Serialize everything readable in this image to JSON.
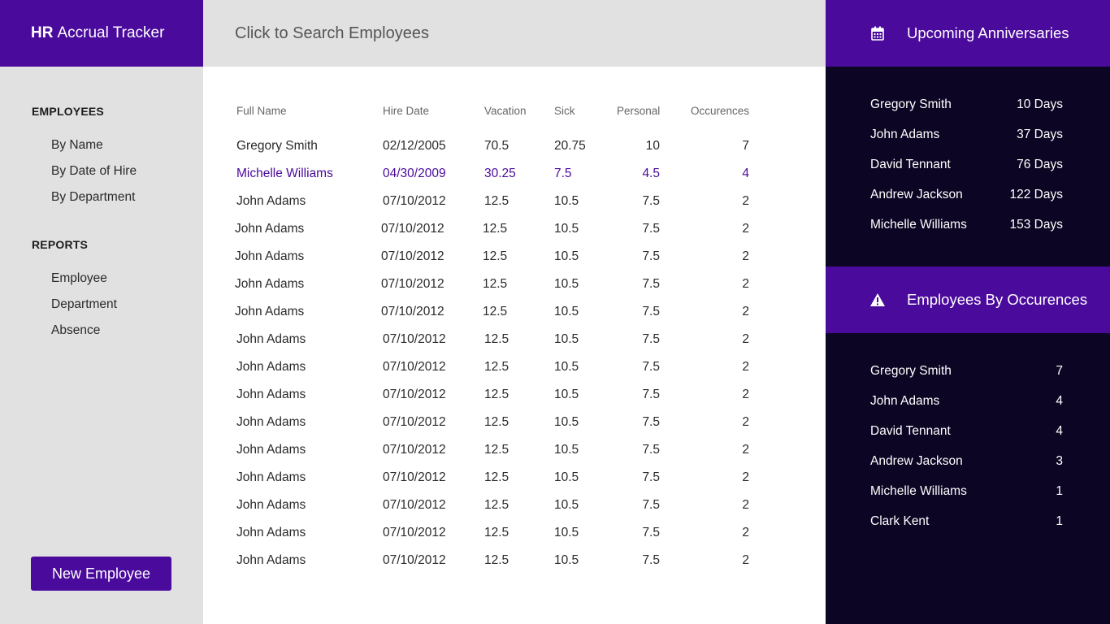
{
  "app": {
    "title_bold": "HR",
    "title_rest": "Accrual Tracker"
  },
  "search": {
    "placeholder": "Click to Search Employees"
  },
  "sidebar": {
    "employees_heading": "EMPLOYEES",
    "employees_items": [
      "By Name",
      "By Date of Hire",
      "By Department"
    ],
    "reports_heading": "REPORTS",
    "reports_items": [
      "Employee",
      "Department",
      "Absence"
    ],
    "new_button": "New Employee"
  },
  "table": {
    "headers": {
      "name": "Full Name",
      "hire": "Hire Date",
      "vacation": "Vacation",
      "sick": "Sick",
      "personal": "Personal",
      "occurences": "Occurences"
    },
    "rows": [
      {
        "name": "Gregory Smith",
        "hire": "02/12/2005",
        "vacation": "70.5",
        "sick": "20.75",
        "personal": "10",
        "occurences": "7"
      },
      {
        "name": "Michelle Williams",
        "hire": "04/30/2009",
        "vacation": "30.25",
        "sick": "7.5",
        "personal": "4.5",
        "occurences": "4"
      },
      {
        "name": "John Adams",
        "hire": "07/10/2012",
        "vacation": "12.5",
        "sick": "10.5",
        "personal": "7.5",
        "occurences": "2"
      },
      {
        "name": "John Adams",
        "hire": "07/10/2012",
        "vacation": "12.5",
        "sick": "10.5",
        "personal": "7.5",
        "occurences": "2"
      },
      {
        "name": "John Adams",
        "hire": "07/10/2012",
        "vacation": "12.5",
        "sick": "10.5",
        "personal": "7.5",
        "occurences": "2"
      },
      {
        "name": "John Adams",
        "hire": "07/10/2012",
        "vacation": "12.5",
        "sick": "10.5",
        "personal": "7.5",
        "occurences": "2"
      },
      {
        "name": "John Adams",
        "hire": "07/10/2012",
        "vacation": "12.5",
        "sick": "10.5",
        "personal": "7.5",
        "occurences": "2"
      },
      {
        "name": "John Adams",
        "hire": "07/10/2012",
        "vacation": "12.5",
        "sick": "10.5",
        "personal": "7.5",
        "occurences": "2"
      },
      {
        "name": "John Adams",
        "hire": "07/10/2012",
        "vacation": "12.5",
        "sick": "10.5",
        "personal": "7.5",
        "occurences": "2"
      },
      {
        "name": "John Adams",
        "hire": "07/10/2012",
        "vacation": "12.5",
        "sick": "10.5",
        "personal": "7.5",
        "occurences": "2"
      },
      {
        "name": "John Adams",
        "hire": "07/10/2012",
        "vacation": "12.5",
        "sick": "10.5",
        "personal": "7.5",
        "occurences": "2"
      },
      {
        "name": "John Adams",
        "hire": "07/10/2012",
        "vacation": "12.5",
        "sick": "10.5",
        "personal": "7.5",
        "occurences": "2"
      },
      {
        "name": "John Adams",
        "hire": "07/10/2012",
        "vacation": "12.5",
        "sick": "10.5",
        "personal": "7.5",
        "occurences": "2"
      },
      {
        "name": "John Adams",
        "hire": "07/10/2012",
        "vacation": "12.5",
        "sick": "10.5",
        "personal": "7.5",
        "occurences": "2"
      },
      {
        "name": "John Adams",
        "hire": "07/10/2012",
        "vacation": "12.5",
        "sick": "10.5",
        "personal": "7.5",
        "occurences": "2"
      },
      {
        "name": "John Adams",
        "hire": "07/10/2012",
        "vacation": "12.5",
        "sick": "10.5",
        "personal": "7.5",
        "occurences": "2"
      }
    ]
  },
  "anniversaries": {
    "title": "Upcoming Anniversaries",
    "icon": "calendar-icon",
    "items": [
      {
        "name": "Gregory Smith",
        "value": "10 Days"
      },
      {
        "name": "John Adams",
        "value": "37 Days"
      },
      {
        "name": "David Tennant",
        "value": "76 Days"
      },
      {
        "name": "Andrew Jackson",
        "value": "122 Days"
      },
      {
        "name": "Michelle Williams",
        "value": "153 Days"
      }
    ]
  },
  "occurences": {
    "title": "Employees By Occurences",
    "icon": "warning-icon",
    "items": [
      {
        "name": "Gregory Smith",
        "value": "7"
      },
      {
        "name": "John Adams",
        "value": "4"
      },
      {
        "name": "David Tennant",
        "value": "4"
      },
      {
        "name": "Andrew Jackson",
        "value": "3"
      },
      {
        "name": "Michelle Williams",
        "value": "1"
      },
      {
        "name": "Clark Kent",
        "value": "1"
      }
    ]
  },
  "colors": {
    "accent": "#4a0a9c",
    "dark_panel": "#0d0524",
    "light_panel": "#e1e1e1"
  }
}
